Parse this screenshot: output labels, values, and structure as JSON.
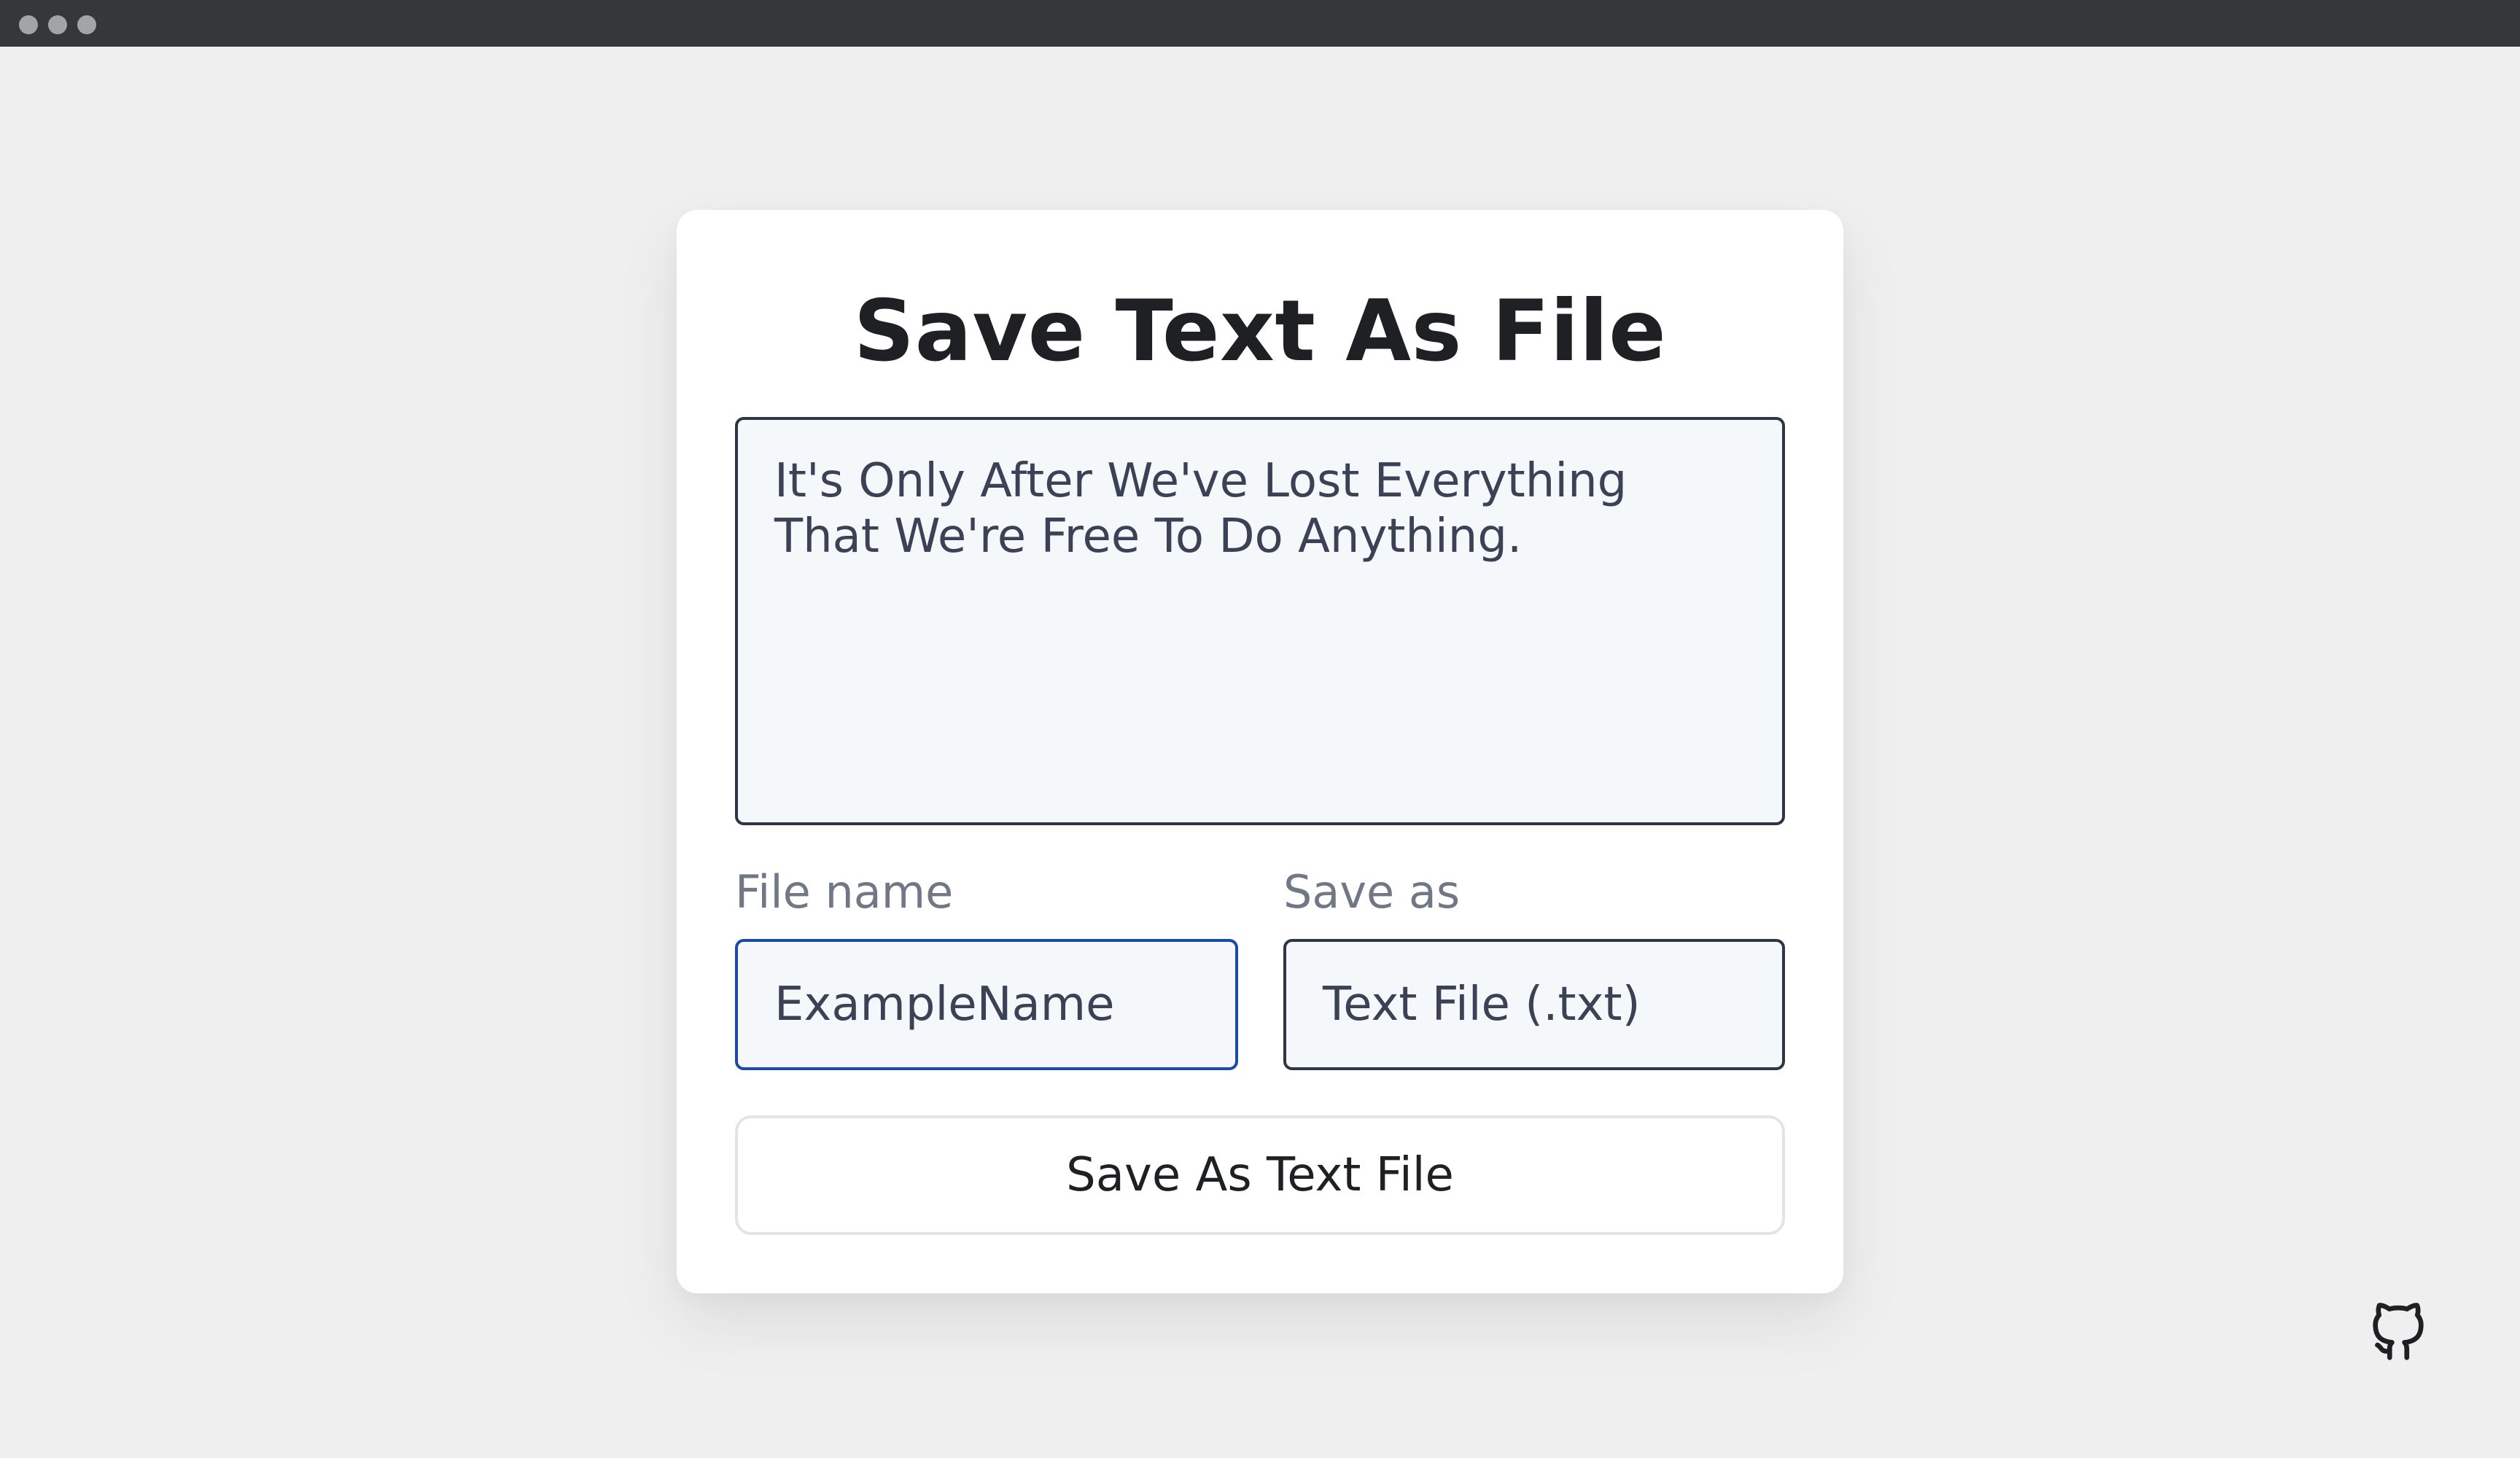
{
  "window": {
    "controls": [
      "close",
      "minimize",
      "maximize"
    ]
  },
  "card": {
    "title": "Save Text As File",
    "text_content": "It's Only After We've Lost Everything That We're Free To Do Anything.",
    "file_name": {
      "label": "File name",
      "value": "ExampleName"
    },
    "save_as": {
      "label": "Save as",
      "selected": "Text File (.txt)"
    },
    "save_button_label": "Save As Text File"
  },
  "icons": {
    "github": "github-icon"
  },
  "colors": {
    "page_background": "#efefef",
    "titlebar": "#36373b",
    "card_background": "#ffffff",
    "field_background": "#f4f8fb",
    "focused_border": "#1d4aa6",
    "default_border": "#2e3545",
    "text_primary": "#1e2024",
    "text_muted": "#717885"
  }
}
